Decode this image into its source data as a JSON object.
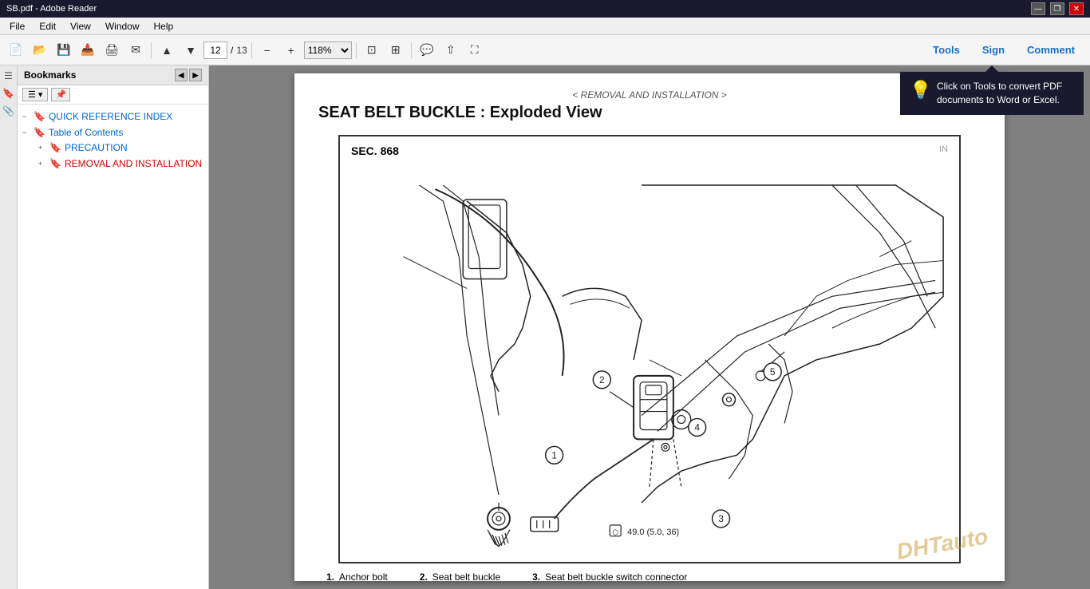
{
  "window": {
    "title": "SB.pdf - Adobe Reader"
  },
  "titlebar": {
    "minimize": "—",
    "restore": "❐",
    "close": "✕"
  },
  "menubar": {
    "items": [
      "File",
      "Edit",
      "View",
      "Window",
      "Help"
    ]
  },
  "toolbar": {
    "prev_icon": "◀",
    "next_icon": "▶",
    "current_page": "12",
    "total_pages": "13",
    "zoom_out": "−",
    "zoom_in": "+",
    "zoom_value": "118%",
    "fit_page": "⊡",
    "fit_width": "⊞",
    "comment_icon": "💬",
    "share_icon": "⇧",
    "fullscreen_icon": "⛶",
    "tools_label": "Tools",
    "sign_label": "Sign",
    "comment_label": "Comment"
  },
  "bookmarks_panel": {
    "title": "Bookmarks",
    "nav_left": "◀",
    "nav_right": "▶",
    "toolbar_btn": "☰",
    "items": [
      {
        "id": "quick-ref",
        "expand": "−",
        "text": "QUICK REFERENCE INDEX",
        "active": false,
        "children": []
      },
      {
        "id": "toc",
        "expand": "−",
        "text": "Table of Contents",
        "active": false,
        "children": [
          {
            "id": "precaution",
            "expand": "+",
            "text": "PRECAUTION",
            "active": false
          },
          {
            "id": "removal",
            "expand": "+",
            "text": "REMOVAL AND INSTALLATION",
            "active": true
          }
        ]
      }
    ]
  },
  "pdf": {
    "header_nav": "< REMOVAL AND INSTALLATION >",
    "title": "SEAT BELT BUCKLE : Exploded View",
    "section_label": "SEC. 868",
    "section_note": "IN",
    "parts": [
      {
        "num": "1.",
        "label": "Anchor bolt"
      },
      {
        "num": "2.",
        "label": "Seat belt buckle"
      },
      {
        "num": "3.",
        "label": "Seat belt buckle switch connector"
      }
    ],
    "torque_label": "49.0 (5.0, 36)"
  },
  "tooltip": {
    "icon": "💡",
    "text": "Click on Tools to convert PDF documents to Word or Excel."
  }
}
